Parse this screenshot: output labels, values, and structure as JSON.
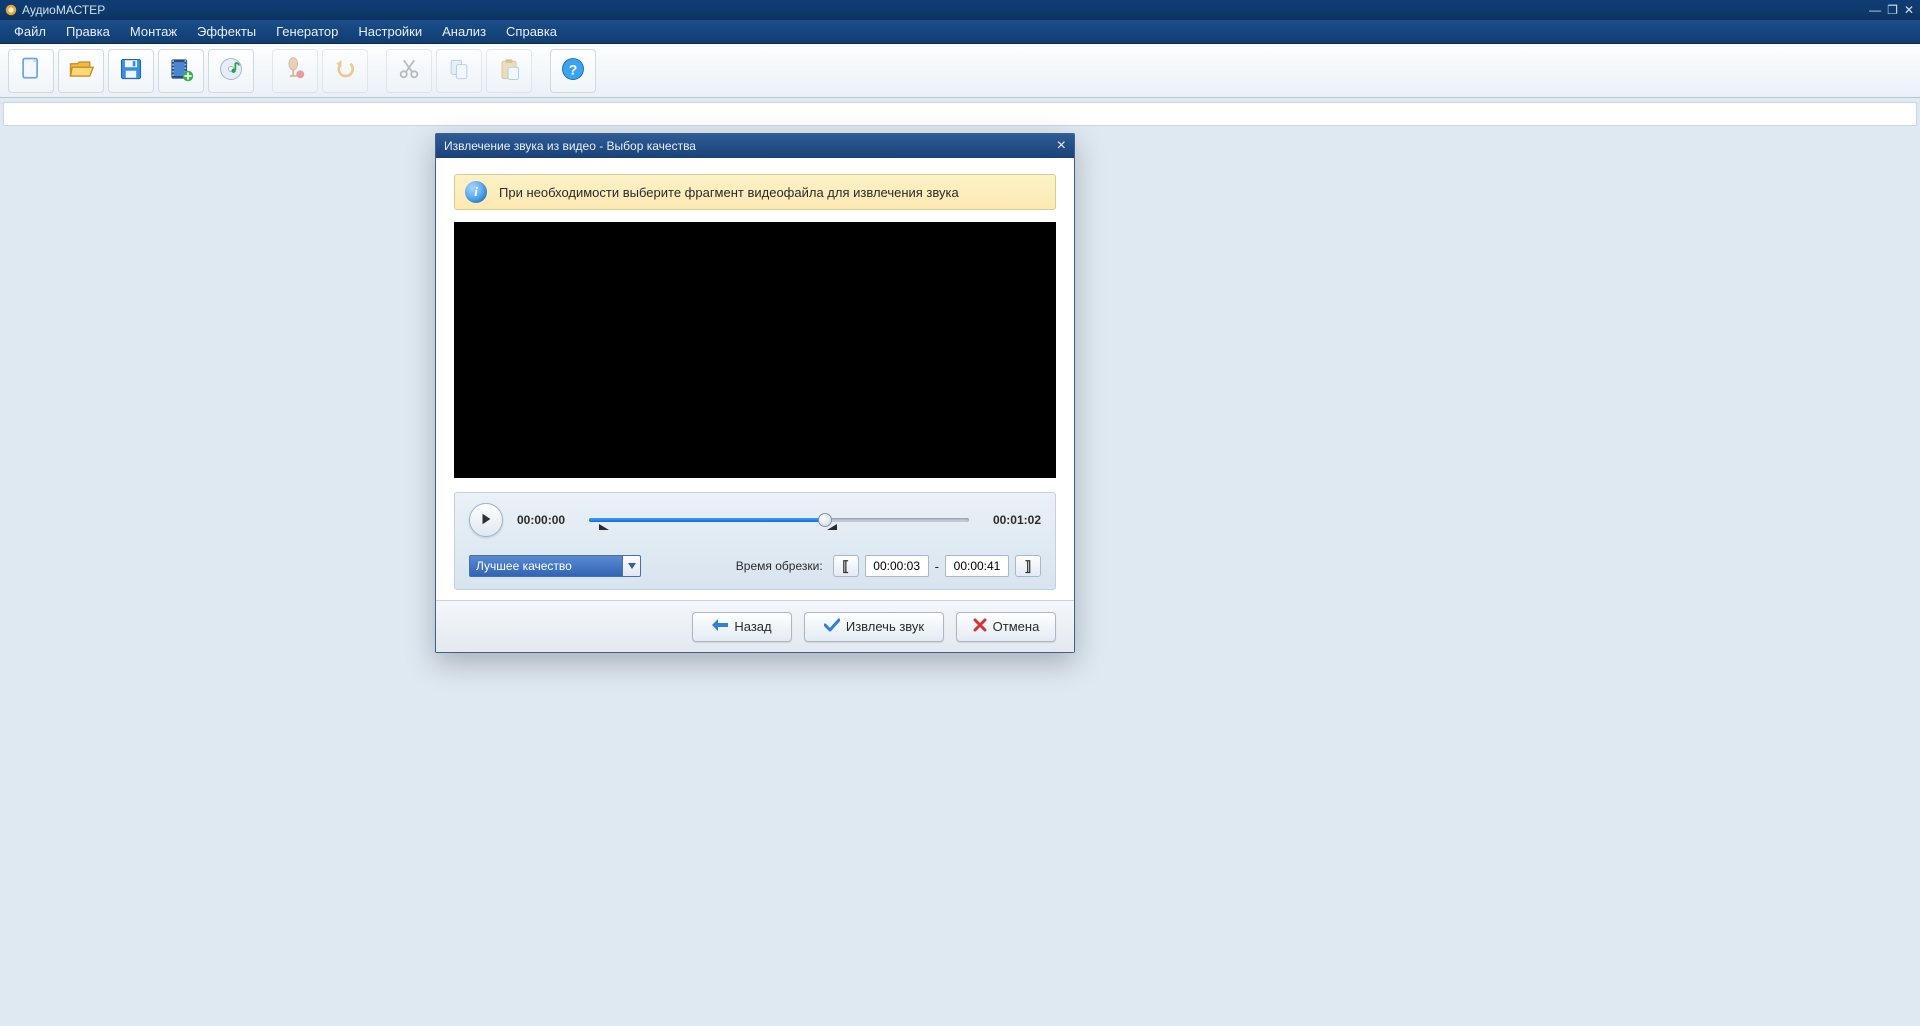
{
  "app": {
    "title": "АудиоМАСТЕР"
  },
  "menu": {
    "file": "Файл",
    "edit": "Правка",
    "montage": "Монтаж",
    "effects": "Эффекты",
    "generator": "Генератор",
    "settings": "Настройки",
    "analysis": "Анализ",
    "help": "Справка"
  },
  "toolbar": {
    "icons": [
      "new",
      "open",
      "save",
      "import-video",
      "cd-audio",
      "record",
      "undo",
      "cut",
      "copy",
      "paste",
      "help"
    ]
  },
  "dialog": {
    "title": "Извлечение звука из видео - Выбор качества",
    "banner": "При необходимости выберите фрагмент видеофайла для извлечения звука",
    "time_current": "00:00:00",
    "time_total": "00:01:02",
    "quality_selected": "Лучшее качество",
    "trim_label": "Время обрезки:",
    "trim_start": "00:00:03",
    "trim_dash": "-",
    "trim_end": "00:00:41",
    "btn_back": "Назад",
    "btn_extract": "Извлечь звук",
    "btn_cancel": "Отмена",
    "slider": {
      "fill_percent": 62,
      "thumb_percent": 62,
      "marker_start_percent": 4,
      "marker_end_percent": 64
    }
  }
}
